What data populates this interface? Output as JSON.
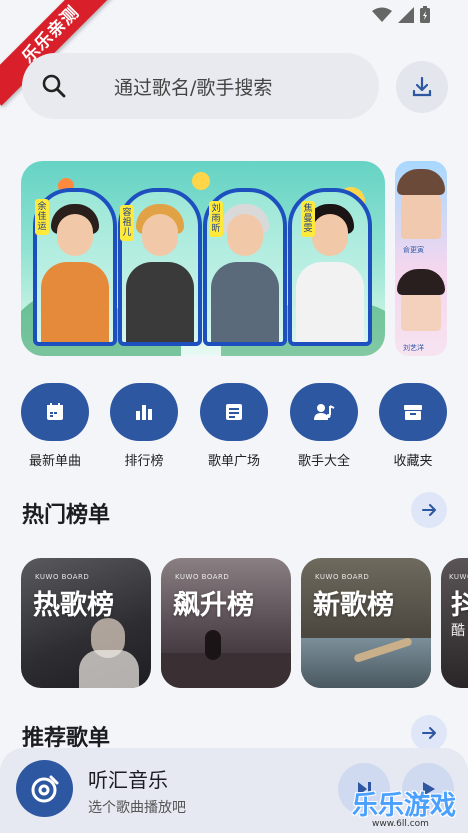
{
  "watermark_ribbon": "乐乐亲测",
  "search": {
    "placeholder": "通过歌名/歌手搜索"
  },
  "banner": {
    "singers": [
      "余佳运",
      "容祖儿",
      "刘雨昕",
      "焦曼雯"
    ],
    "side_singers": [
      "俞更寅",
      "刘艺洋"
    ]
  },
  "quick_nav": [
    {
      "label": "最新单曲",
      "icon": "calendar-icon"
    },
    {
      "label": "排行榜",
      "icon": "bar-chart-icon"
    },
    {
      "label": "歌单广场",
      "icon": "playlist-icon"
    },
    {
      "label": "歌手大全",
      "icon": "singer-icon"
    },
    {
      "label": "收藏夹",
      "icon": "archive-icon"
    }
  ],
  "hot_charts": {
    "title": "热门榜单",
    "cards": [
      {
        "board": "KUWO BOARD",
        "title": "热歌榜"
      },
      {
        "board": "KUWO BOARD",
        "title": "飙升榜"
      },
      {
        "board": "KUWO BOARD",
        "title": "新歌榜"
      },
      {
        "board": "KUWO",
        "title": "抖",
        "subtitle": "酷"
      }
    ]
  },
  "recommended": {
    "title": "推荐歌单"
  },
  "player": {
    "title": "听汇音乐",
    "subtitle": "选个歌曲播放吧"
  },
  "watermark": {
    "text": "乐乐游戏",
    "url": "www.6ll.com"
  },
  "colors": {
    "accent": "#2e57a2",
    "background": "#f4f5f9",
    "ribbon": "#d9202a"
  }
}
